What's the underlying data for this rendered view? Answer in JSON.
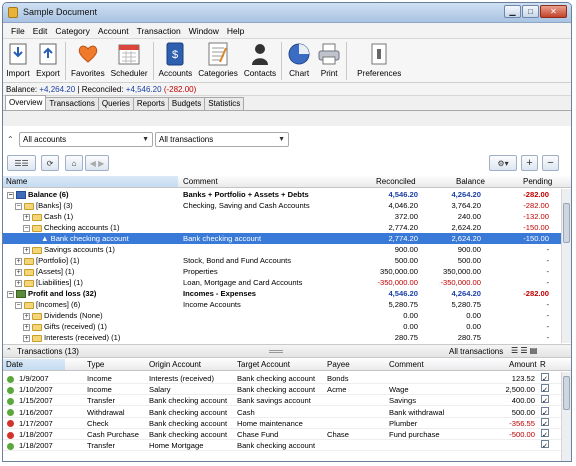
{
  "window": {
    "title": "Sample Document"
  },
  "menu": [
    "File",
    "Edit",
    "Category",
    "Account",
    "Transaction",
    "Window",
    "Help"
  ],
  "toolbar": {
    "import": "Import",
    "export": "Export",
    "favorites": "Favorites",
    "scheduler": "Scheduler",
    "accounts": "Accounts",
    "categories": "Categories",
    "contacts": "Contacts",
    "chart": "Chart",
    "print": "Print",
    "preferences": "Preferences"
  },
  "balance_bar": {
    "balance_label": "Balance:",
    "balance_value": "+4,264.20",
    "reconciled_label": "| Reconciled:",
    "reconciled_value": "+4,546.20",
    "diff_value": "(-282.00)"
  },
  "tabs": [
    "Overview",
    "Transactions",
    "Queries",
    "Reports",
    "Budgets",
    "Statistics"
  ],
  "filters": {
    "accounts": "All accounts",
    "transactions": "All transactions"
  },
  "grid": {
    "headers": {
      "name": "Name",
      "comment": "Comment",
      "reconciled": "Reconciled",
      "balance": "Balance",
      "pending": "Pending"
    },
    "rows": [
      {
        "name": "Balance (6)",
        "comment": "Banks + Portfolio + Assets + Debts",
        "reconciled": "4,546.20",
        "balance": "4,264.20",
        "pending": "-282.00"
      },
      {
        "name": "[Banks] (3)",
        "comment": "Checking, Saving and Cash Accounts",
        "reconciled": "4,046.20",
        "balance": "3,764.20",
        "pending": "-282.00"
      },
      {
        "name": "Cash (1)",
        "comment": "",
        "reconciled": "372.00",
        "balance": "240.00",
        "pending": "-132.00"
      },
      {
        "name": "Checking accounts (1)",
        "comment": "",
        "reconciled": "2,774.20",
        "balance": "2,624.20",
        "pending": "-150.00"
      },
      {
        "name": "Bank checking account",
        "comment": "Bank checking account",
        "reconciled": "2,774.20",
        "balance": "2,624.20",
        "pending": "-150.00"
      },
      {
        "name": "Savings accounts (1)",
        "comment": "",
        "reconciled": "900.00",
        "balance": "900.00",
        "pending": "-"
      },
      {
        "name": "[Portfolio] (1)",
        "comment": "Stock, Bond and Fund Accounts",
        "reconciled": "500.00",
        "balance": "500.00",
        "pending": "-"
      },
      {
        "name": "[Assets] (1)",
        "comment": "Properties",
        "reconciled": "350,000.00",
        "balance": "350,000.00",
        "pending": "-"
      },
      {
        "name": "[Liabilities] (1)",
        "comment": "Loan, Mortgage and Card Accounts",
        "reconciled": "-350,000.00",
        "balance": "-350,000.00",
        "pending": "-"
      },
      {
        "name": "Profit and loss (32)",
        "comment": "Incomes - Expenses",
        "reconciled": "4,546.20",
        "balance": "4,264.20",
        "pending": "-282.00"
      },
      {
        "name": "[Incomes] (6)",
        "comment": "Income Accounts",
        "reconciled": "5,280.75",
        "balance": "5,280.75",
        "pending": "-"
      },
      {
        "name": "Dividends (None)",
        "comment": "",
        "reconciled": "0.00",
        "balance": "0.00",
        "pending": "-"
      },
      {
        "name": "Gifts (received) (1)",
        "comment": "",
        "reconciled": "0.00",
        "balance": "0.00",
        "pending": "-"
      },
      {
        "name": "Interests (received) (1)",
        "comment": "",
        "reconciled": "280.75",
        "balance": "280.75",
        "pending": "-"
      }
    ]
  },
  "transactions": {
    "title": "Transactions (13)",
    "filter": "All transactions",
    "headers": {
      "date": "Date",
      "type": "Type",
      "origin": "Origin Account",
      "target": "Target Account",
      "payee": "Payee",
      "comment": "Comment",
      "amount": "Amount",
      "r": "R"
    },
    "rows": [
      {
        "date": "1/9/2007",
        "type": "Income",
        "origin": "Interests (received)",
        "target": "Bank checking account",
        "payee": "Bonds",
        "comment": "",
        "amount": "123.52",
        "color": "#5aa83c"
      },
      {
        "date": "1/10/2007",
        "type": "Income",
        "origin": "Salary",
        "target": "Bank checking account",
        "payee": "Acme",
        "comment": "Wage",
        "amount": "2,500.00",
        "color": "#5aa83c"
      },
      {
        "date": "1/15/2007",
        "type": "Transfer",
        "origin": "Bank checking account",
        "target": "Bank savings account",
        "payee": "",
        "comment": "Savings",
        "amount": "400.00",
        "color": "#5aa83c"
      },
      {
        "date": "1/16/2007",
        "type": "Withdrawal",
        "origin": "Bank checking account",
        "target": "Cash",
        "payee": "",
        "comment": "Bank withdrawal",
        "amount": "500.00",
        "color": "#5aa83c"
      },
      {
        "date": "1/17/2007",
        "type": "Check",
        "origin": "Bank checking account",
        "target": "Home maintenance",
        "payee": "",
        "comment": "Plumber",
        "amount": "-356.55",
        "color": "#d0342c"
      },
      {
        "date": "1/18/2007",
        "type": "Cash Purchase",
        "origin": "Bank checking account",
        "target": "Chase Fund",
        "payee": "Chase",
        "comment": "Fund purchase",
        "amount": "-500.00",
        "color": "#d0342c"
      },
      {
        "date": "1/18/2007",
        "type": "Transfer",
        "origin": "Home Mortgage",
        "target": "Bank checking account",
        "payee": "",
        "comment": "",
        "amount": "",
        "color": "#5aa83c"
      }
    ]
  }
}
